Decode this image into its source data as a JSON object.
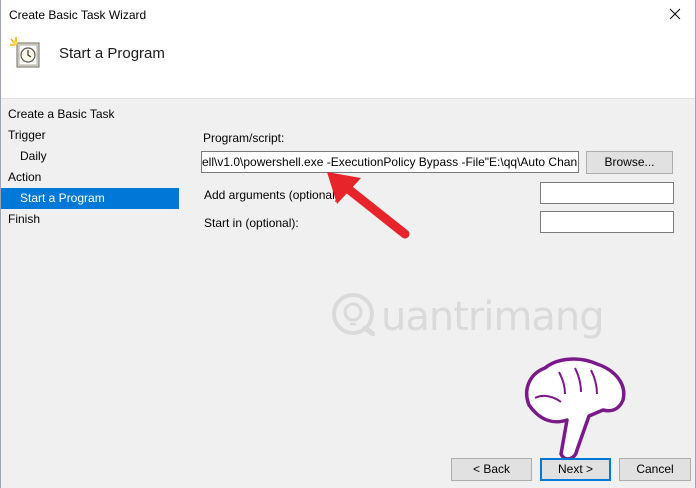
{
  "window": {
    "title": "Create Basic Task Wizard"
  },
  "header": {
    "title": "Start a Program",
    "icon": "task-scheduler-clock-icon"
  },
  "steps": [
    {
      "label": "Create a Basic Task",
      "active": false,
      "indent": false
    },
    {
      "label": "Trigger",
      "active": false,
      "indent": false
    },
    {
      "label": "Daily",
      "active": false,
      "indent": true
    },
    {
      "label": "Action",
      "active": false,
      "indent": false
    },
    {
      "label": "Start a Program",
      "active": true,
      "indent": true
    },
    {
      "label": "Finish",
      "active": false,
      "indent": false
    }
  ],
  "form": {
    "program_label": "Program/script:",
    "program_value": "ell\\v1.0\\powershell.exe -ExecutionPolicy Bypass -File\"E:\\qq\\Auto Chan",
    "browse_label": "Browse...",
    "args_label": "Add arguments (optional):",
    "args_value": "",
    "startin_label": "Start in (optional):",
    "startin_value": ""
  },
  "buttons": {
    "back": "< Back",
    "next": "Next >",
    "cancel": "Cancel"
  },
  "watermark": {
    "text": "uantrimang"
  },
  "colors": {
    "accent": "#0078d7",
    "arrow": "#e8242b"
  }
}
